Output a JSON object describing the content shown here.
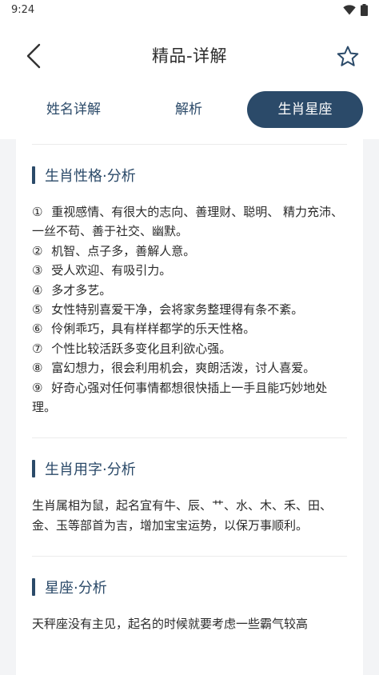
{
  "status_bar": {
    "time": "9:24"
  },
  "header": {
    "title": "精品-详解"
  },
  "tabs": [
    {
      "label": "姓名详解",
      "active": false
    },
    {
      "label": "解析",
      "active": false
    },
    {
      "label": "生肖星座",
      "active": true
    }
  ],
  "sections": {
    "traits": {
      "title": "生肖性格·分析",
      "items": [
        {
          "num": "①",
          "text": "重视感情、有很大的志向、善理财、聪明、 精力充沛、一丝不苟、善于社交、幽默。"
        },
        {
          "num": "②",
          "text": "机智、点子多，善解人意。"
        },
        {
          "num": "③",
          "text": "受人欢迎、有吸引力。"
        },
        {
          "num": "④",
          "text": "多才多艺。"
        },
        {
          "num": "⑤",
          "text": "女性特别喜爱干净，会将家务整理得有条不紊。"
        },
        {
          "num": "⑥",
          "text": "伶俐乖巧，具有样样都学的乐天性格。"
        },
        {
          "num": "⑦",
          "text": "个性比较活跃多变化且利欲心强。"
        },
        {
          "num": "⑧",
          "text": "富幻想力，很会利用机会，爽朗活泼，讨人喜爱。"
        },
        {
          "num": "⑨",
          "text": "好奇心强对任何事情都想很快插上一手且能巧妙地处理。"
        }
      ]
    },
    "naming": {
      "title": "生肖用字·分析",
      "text": "生肖属相为鼠，起名宜有牛、辰、艹、水、木、禾、田、金、玉等部首为吉，增加宝宝运势，以保万事顺利。"
    },
    "zodiac": {
      "title": "星座·分析",
      "text": "天秤座没有主见，起名的时候就要考虑一些霸气较高"
    }
  },
  "colors": {
    "accent": "#2b4a69",
    "background": "#f3f4f6"
  }
}
